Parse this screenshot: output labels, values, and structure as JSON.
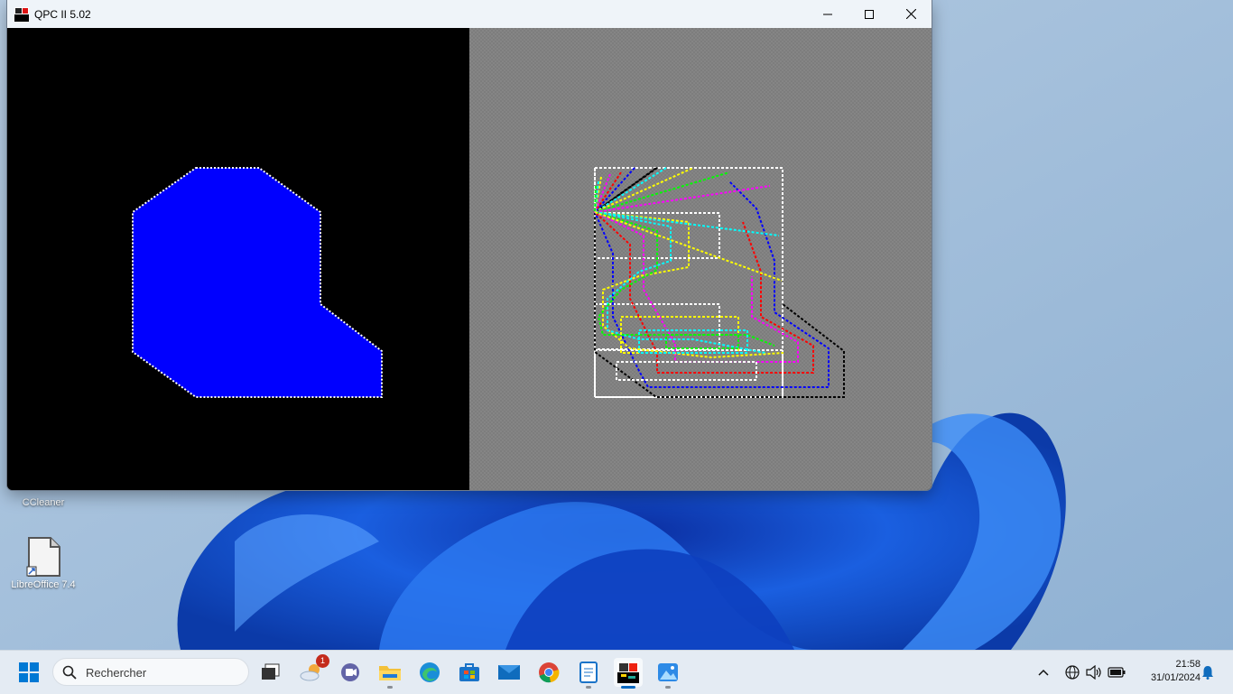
{
  "window": {
    "title": "QPC II 5.02",
    "minimize_icon": "minimize-icon",
    "maximize_icon": "maximize-icon",
    "close_icon": "close-icon"
  },
  "colors": {
    "left_pane_bg": "#000000",
    "right_pane_bg": "#808080",
    "shape_fill": "#0000ff",
    "shape_outline": "#ffffff"
  },
  "desktop": {
    "icons": [
      {
        "label": "CCleaner",
        "icon": "ccleaner-icon"
      },
      {
        "label": "LibreOffice 7.4",
        "icon": "libreoffice-icon"
      }
    ]
  },
  "taskbar": {
    "start_icon": "windows-start-icon",
    "search_placeholder": "Rechercher",
    "apps": [
      {
        "name": "task-view",
        "icon": "task-view-icon"
      },
      {
        "name": "weather",
        "icon": "weather-icon",
        "badge": "1"
      },
      {
        "name": "teams",
        "icon": "teams-icon"
      },
      {
        "name": "file-explorer",
        "icon": "folder-icon"
      },
      {
        "name": "edge",
        "icon": "edge-icon"
      },
      {
        "name": "store",
        "icon": "store-icon"
      },
      {
        "name": "mail",
        "icon": "mail-icon"
      },
      {
        "name": "chrome",
        "icon": "chrome-icon"
      },
      {
        "name": "notepad",
        "icon": "notepad-icon"
      },
      {
        "name": "qpc",
        "icon": "qpc-icon"
      },
      {
        "name": "photos",
        "icon": "photos-icon"
      }
    ],
    "tray": {
      "chevron": "chevron-up-icon",
      "network": "globe-icon",
      "volume": "speaker-icon",
      "battery": "battery-icon",
      "notifications": "bell-icon"
    },
    "time": "21:58",
    "date": "31/01/2024"
  }
}
